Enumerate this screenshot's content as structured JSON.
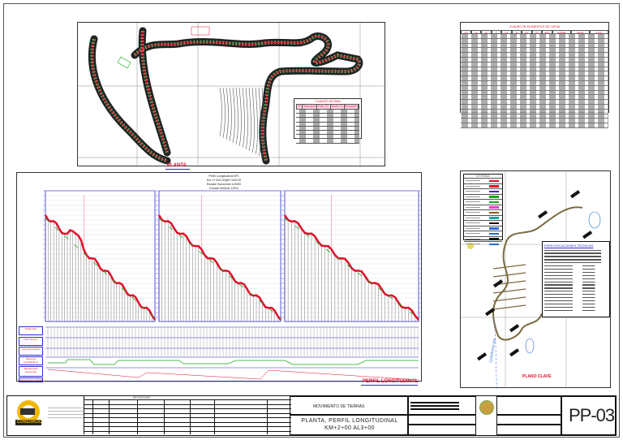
{
  "plan": {
    "title": "PLANTA",
    "curve_table": {
      "title": "CUADRO DE ELEMENTOS DE CURVA",
      "headers": [
        "PI",
        "Δ",
        "R",
        "T",
        "LC",
        "E",
        "PC",
        "PT",
        "EXT",
        "NORTE",
        "ESTE",
        "PI (K)"
      ],
      "row_count": 20
    },
    "bm_table": {
      "title": "CUADRO DE BMs",
      "headers": [
        "N°",
        "Descripción",
        "Este (X)",
        "Norte (Y)",
        "Elevación (Z)"
      ],
      "row_count": 8
    }
  },
  "profile": {
    "header_lines": [
      "Perfil Longitudinal Nº1",
      "Km 2+310.00@2+440.00",
      "Escala Horizontal 1/2000",
      "Escala Vertical 1/200"
    ],
    "title": "PERFIL LONGITUDINAL",
    "band_labels": [
      "Progresiva",
      "Cota Terreno",
      "Cota Sub-rasante",
      "Altura de Corte/Relleno",
      "Alineamiento Horizontal",
      "Alineamiento Vertical"
    ],
    "colors": {
      "terrain": "#e0102a",
      "grade": "#1aa81a",
      "frame": "#2b2bd6"
    }
  },
  "key_plan": {
    "title": "PLANO CLAVE",
    "river_label": "QUEBRADA S/N",
    "specs_title": "ESPECIFICACIONES TECNICAS",
    "legend_title": "LEYENDA"
  },
  "title_block": {
    "company": "CONSORCIO",
    "specialty": "MOVIMIENTO DE TIERRAS",
    "plan_name_line1": "PLANTA, PERFIL LONGITUDINAL",
    "plan_name_line2": "KM+2+00 AL3+00",
    "sheet_code": "PP-03",
    "revisions_header": "REVISIONES"
  }
}
